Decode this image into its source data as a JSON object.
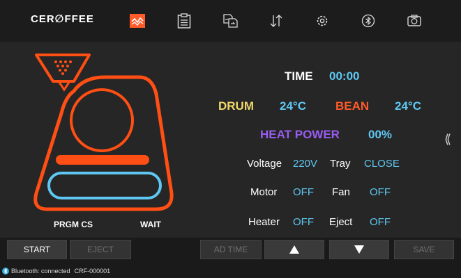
{
  "app": {
    "logo": "CER∅FFEE"
  },
  "toolbar": {
    "icons": [
      "chart-icon",
      "clipboard-icon",
      "file-transfer-icon",
      "sort-arrows-icon",
      "gear-icon",
      "bluetooth-icon",
      "camera-icon"
    ],
    "active_color": "#ff5a2a"
  },
  "machine": {
    "program_label": "PRGM CS",
    "state_label": "WAIT",
    "outline_color": "#ff4f14",
    "chamber_color": "#5ec8f2"
  },
  "readouts": {
    "time": {
      "label": "TIME",
      "value": "00:00"
    },
    "drum": {
      "label": "DRUM",
      "value": "24°C"
    },
    "bean": {
      "label": "BEAN",
      "value": "24°C"
    },
    "heat_power": {
      "label": "HEAT POWER",
      "value": "00%"
    },
    "voltage": {
      "label": "Voltage",
      "value": "220V"
    },
    "tray": {
      "label": "Tray",
      "value": "CLOSE"
    },
    "motor": {
      "label": "Motor",
      "value": "OFF"
    },
    "fan": {
      "label": "Fan",
      "value": "OFF"
    },
    "heater": {
      "label": "Heater",
      "value": "OFF"
    },
    "eject": {
      "label": "Eject",
      "value": "OFF"
    }
  },
  "panel": {
    "collapse_glyph": "⟪"
  },
  "controls": {
    "start": "START",
    "eject": "EJECT",
    "ad_time": "AD TIME",
    "up_icon": "triangle-up-icon",
    "down_icon": "triangle-down-icon",
    "save": "SAVE"
  },
  "status": {
    "bluetooth": "Bluetooth: connected",
    "device": "CRF-000001"
  }
}
